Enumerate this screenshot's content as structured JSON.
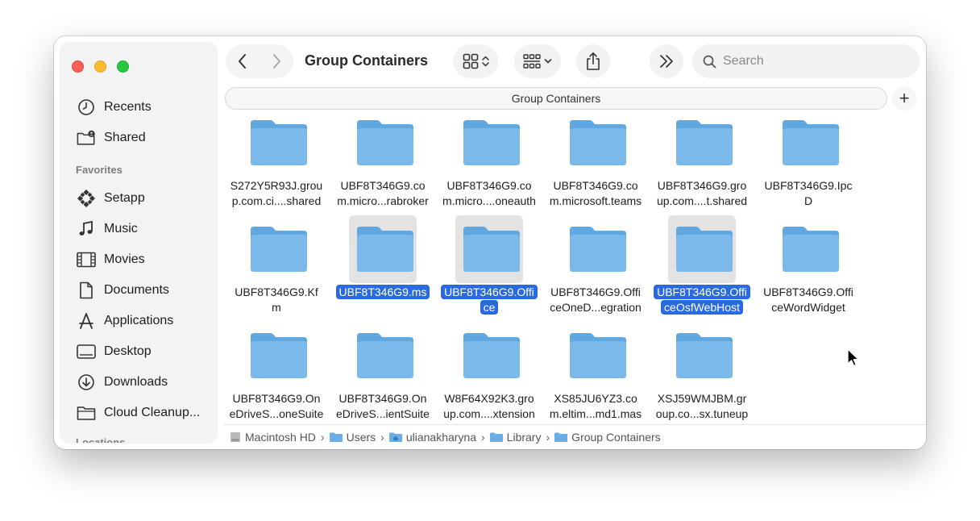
{
  "window": {
    "title": "Group Containers",
    "search_placeholder": "Search",
    "pathbar_label": "Group Containers",
    "plus_label": "+"
  },
  "sidebar": {
    "items_top": [
      {
        "label": "Recents",
        "icon": "clock-icon"
      },
      {
        "label": "Shared",
        "icon": "shared-folder-icon"
      }
    ],
    "favorites_heading": "Favorites",
    "favorites": [
      {
        "label": "Setapp",
        "icon": "setapp-icon"
      },
      {
        "label": "Music",
        "icon": "music-note-icon"
      },
      {
        "label": "Movies",
        "icon": "film-icon"
      },
      {
        "label": "Documents",
        "icon": "document-icon"
      },
      {
        "label": "Applications",
        "icon": "applications-icon"
      },
      {
        "label": "Desktop",
        "icon": "desktop-icon"
      },
      {
        "label": "Downloads",
        "icon": "download-icon"
      },
      {
        "label": "Cloud Cleanup...",
        "icon": "folder-icon"
      }
    ],
    "locations_heading": "Locations"
  },
  "files": [
    {
      "name": "S272Y5R93J.group.com.ci....shared",
      "lines": [
        "S272Y5R93J.grou",
        "p.com.ci....shared"
      ],
      "selected": false
    },
    {
      "name": "UBF8T346G9.com.micro...rabroker",
      "lines": [
        "UBF8T346G9.co",
        "m.micro...rabroker"
      ],
      "selected": false
    },
    {
      "name": "UBF8T346G9.com.micro....oneauth",
      "lines": [
        "UBF8T346G9.co",
        "m.micro....oneauth"
      ],
      "selected": false
    },
    {
      "name": "UBF8T346G9.com.microsoft.teams",
      "lines": [
        "UBF8T346G9.co",
        "m.microsoft.teams"
      ],
      "selected": false
    },
    {
      "name": "UBF8T346G9.group.com....t.shared",
      "lines": [
        "UBF8T346G9.gro",
        "up.com....t.shared"
      ],
      "selected": false
    },
    {
      "name": "UBF8T346G9.IpcD",
      "lines": [
        "UBF8T346G9.Ipc",
        "D"
      ],
      "selected": false
    },
    {
      "name": "UBF8T346G9.Kfm",
      "lines": [
        "UBF8T346G9.Kf",
        "m"
      ],
      "selected": false
    },
    {
      "name": "UBF8T346G9.ms",
      "lines": [
        "UBF8T346G9.ms",
        ""
      ],
      "selected": true
    },
    {
      "name": "UBF8T346G9.Office",
      "lines": [
        "UBF8T346G9.Offi",
        "ce"
      ],
      "selected": true
    },
    {
      "name": "UBF8T346G9.OfficeOneD...egration",
      "lines": [
        "UBF8T346G9.Offi",
        "ceOneD...egration"
      ],
      "selected": false
    },
    {
      "name": "UBF8T346G9.OfficeOsfWebHost",
      "lines": [
        "UBF8T346G9.Offi",
        "ceOsfWebHost"
      ],
      "selected": true
    },
    {
      "name": "UBF8T346G9.OfficeWordWidget",
      "lines": [
        "UBF8T346G9.Offi",
        "ceWordWidget"
      ],
      "selected": false
    },
    {
      "name": "UBF8T346G9.OneDriveS...oneSuite",
      "lines": [
        "UBF8T346G9.On",
        "eDriveS...oneSuite"
      ],
      "selected": false
    },
    {
      "name": "UBF8T346G9.OneDriveS...ientSuite",
      "lines": [
        "UBF8T346G9.On",
        "eDriveS...ientSuite"
      ],
      "selected": false
    },
    {
      "name": "W8F64X92K3.group.com....xtension",
      "lines": [
        "W8F64X92K3.gro",
        "up.com....xtension"
      ],
      "selected": false
    },
    {
      "name": "XS85JU6YZ3.com.eltim...md1.mas",
      "lines": [
        "XS85JU6YZ3.co",
        "m.eltim...md1.mas"
      ],
      "selected": false
    },
    {
      "name": "XSJ59WMJBM.group.co...sx.tuneup",
      "lines": [
        "XSJ59WMJBM.gr",
        "oup.co...sx.tuneup"
      ],
      "selected": false
    }
  ],
  "breadcrumbs": [
    "Macintosh HD",
    "Users",
    "ulianakharyna",
    "Library",
    "Group Containers"
  ],
  "colors": {
    "folder": "#7ab9ea",
    "selection": "#2a6ae0",
    "close": "#fe5f57",
    "minimize": "#febc2e",
    "zoom": "#28c840"
  }
}
